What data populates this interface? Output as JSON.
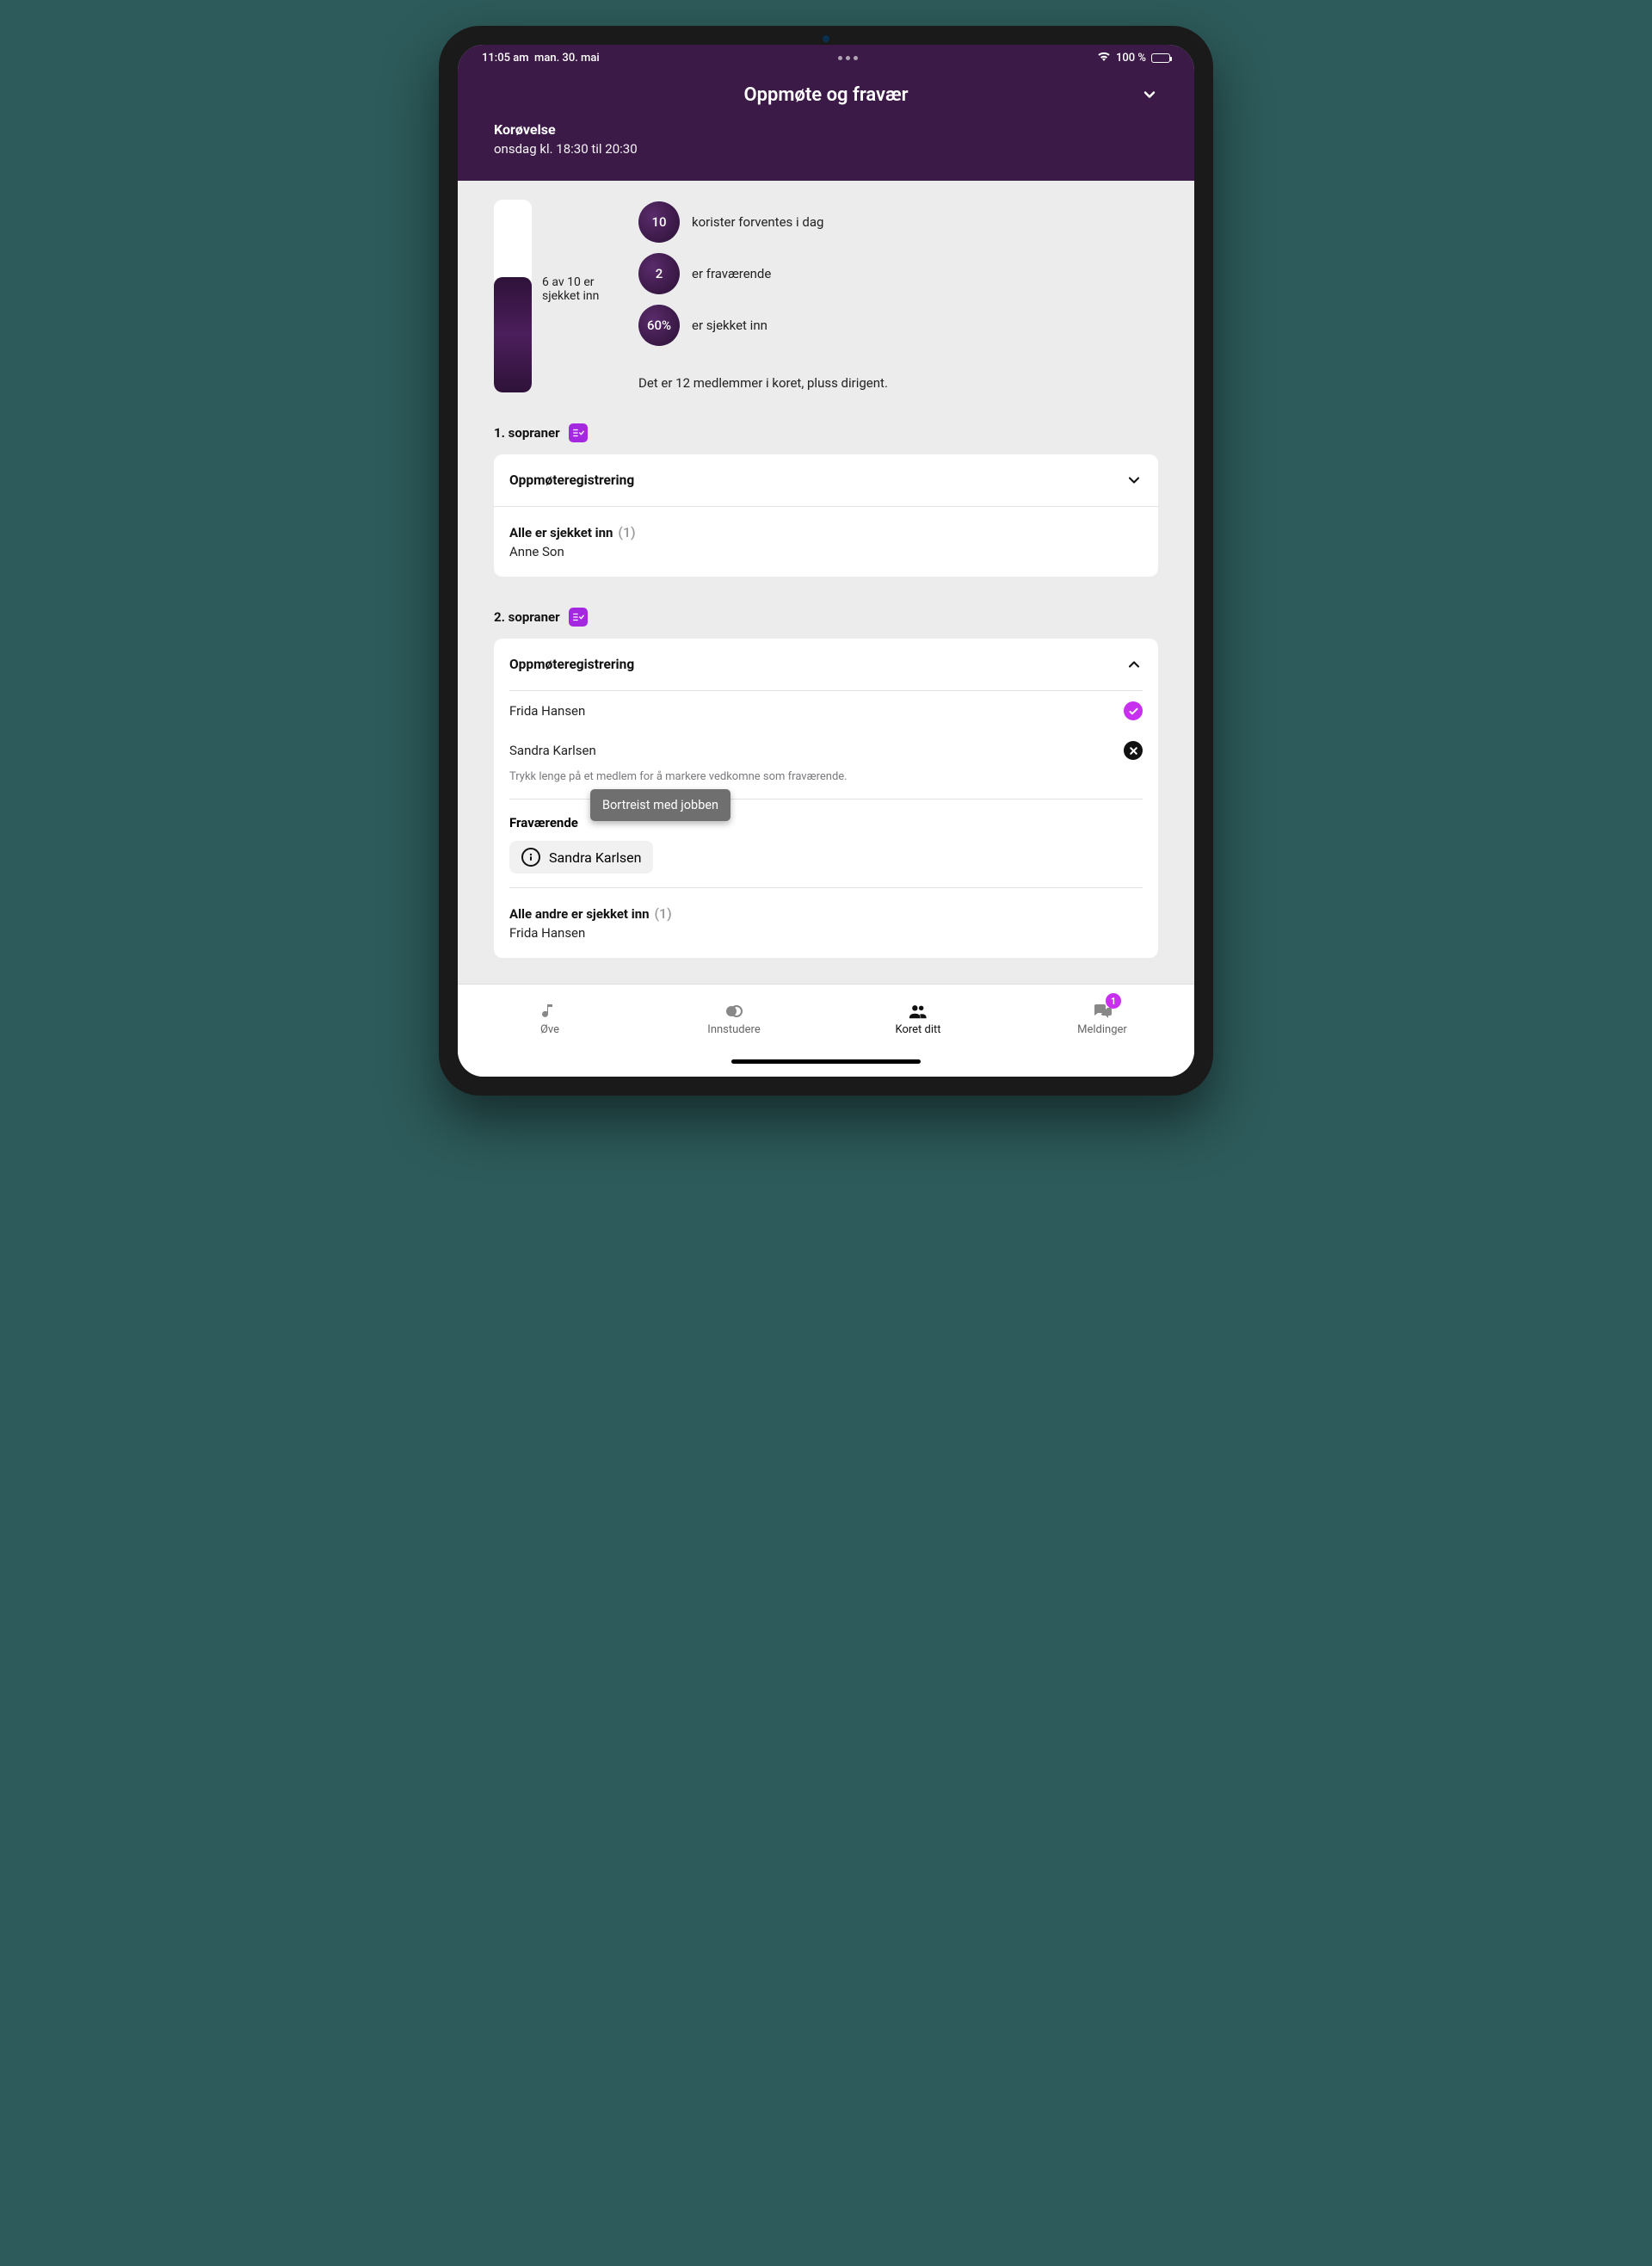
{
  "status": {
    "time": "11:05 am",
    "date": "man. 30. mai",
    "battery_text": "100 %"
  },
  "header": {
    "title": "Oppmøte og fravær",
    "event_type": "Korøvelse",
    "event_time": "onsdag kl. 18:30 til 20:30"
  },
  "stats": {
    "progress_label": "6 av 10 er sjekket inn",
    "progress_pct": 60,
    "expected_count": "10",
    "expected_text": "korister forventes i dag",
    "absent_count": "2",
    "absent_text": "er fraværende",
    "checked_pct": "60%",
    "checked_text": "er sjekket inn",
    "footer": "Det er 12 medlemmer i koret, pluss dirigent."
  },
  "sections": {
    "s1": {
      "title": "1. sopraner",
      "registration_label": "Oppmøteregistrering",
      "all_checked_label": "Alle er sjekket inn",
      "all_checked_count": "(1)",
      "all_checked_member": "Anne Son"
    },
    "s2": {
      "title": "2. sopraner",
      "registration_label": "Oppmøteregistrering",
      "member1": "Frida Hansen",
      "member2": "Sandra Karlsen",
      "hint": "Trykk lenge på et medlem for å markere vedkomne som fraværende.",
      "absent_label": "Fraværende",
      "absent_member": "Sandra Karlsen",
      "tooltip": "Bortreist med jobben",
      "others_checked_label": "Alle andre er sjekket inn",
      "others_checked_count": "(1)",
      "others_checked_member": "Frida Hansen"
    }
  },
  "tabs": {
    "t1": "Øve",
    "t2": "Innstudere",
    "t3": "Koret ditt",
    "t4": "Meldinger",
    "badge": "1"
  }
}
